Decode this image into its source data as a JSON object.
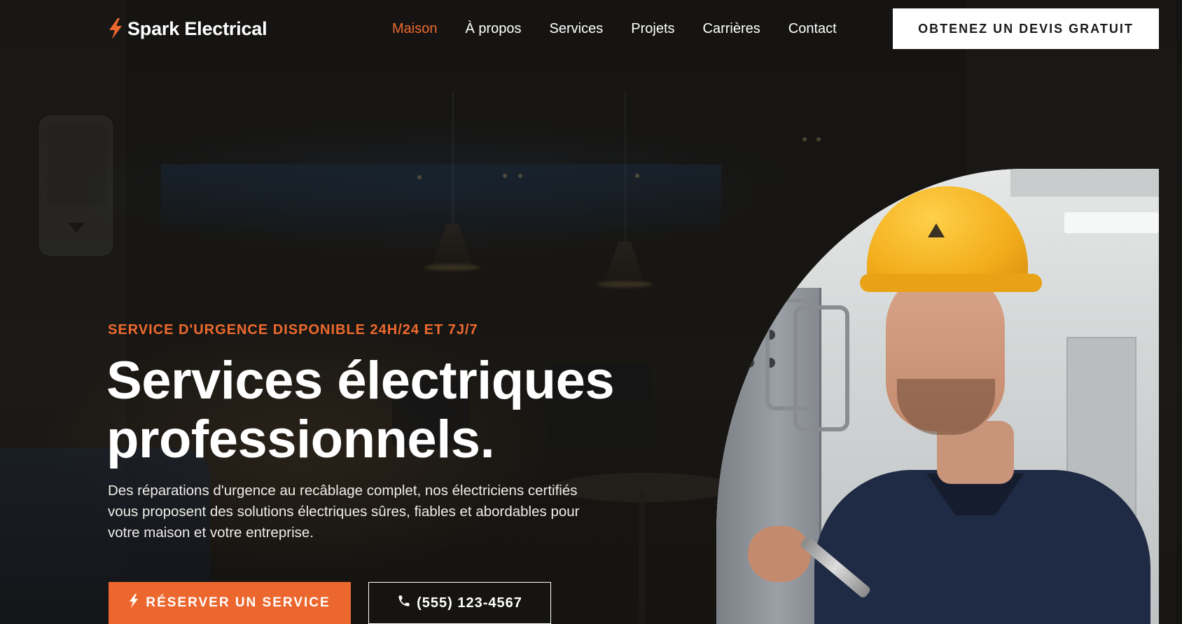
{
  "brand": {
    "name": "Spark Electrical",
    "accent_color": "#ec672e",
    "logo_icon": "lightning-bolt-icon"
  },
  "nav": {
    "items": [
      {
        "label": "Maison",
        "active": true
      },
      {
        "label": "À propos",
        "active": false
      },
      {
        "label": "Services",
        "active": false
      },
      {
        "label": "Projets",
        "active": false
      },
      {
        "label": "Carrières",
        "active": false
      },
      {
        "label": "Contact",
        "active": false
      }
    ],
    "cta_label": "OBTENEZ UN DEVIS GRATUIT"
  },
  "hero": {
    "eyebrow": "SERVICE D'URGENCE DISPONIBLE 24H/24 ET 7J/7",
    "title_line1": "Services électriques",
    "title_line2": "professionnels.",
    "description": "Des réparations d'urgence au recâblage complet, nos électriciens certifiés vous proposent des solutions électriques sûres, fiables et abordables pour votre maison et votre entreprise.",
    "primary_button": {
      "label": "RÉSERVER UN SERVICE",
      "icon": "lightning-bolt-icon"
    },
    "secondary_button": {
      "label": "(555) 123-4567",
      "icon": "phone-icon"
    },
    "image": {
      "subject": "electrician-in-hard-hat-photo"
    }
  }
}
